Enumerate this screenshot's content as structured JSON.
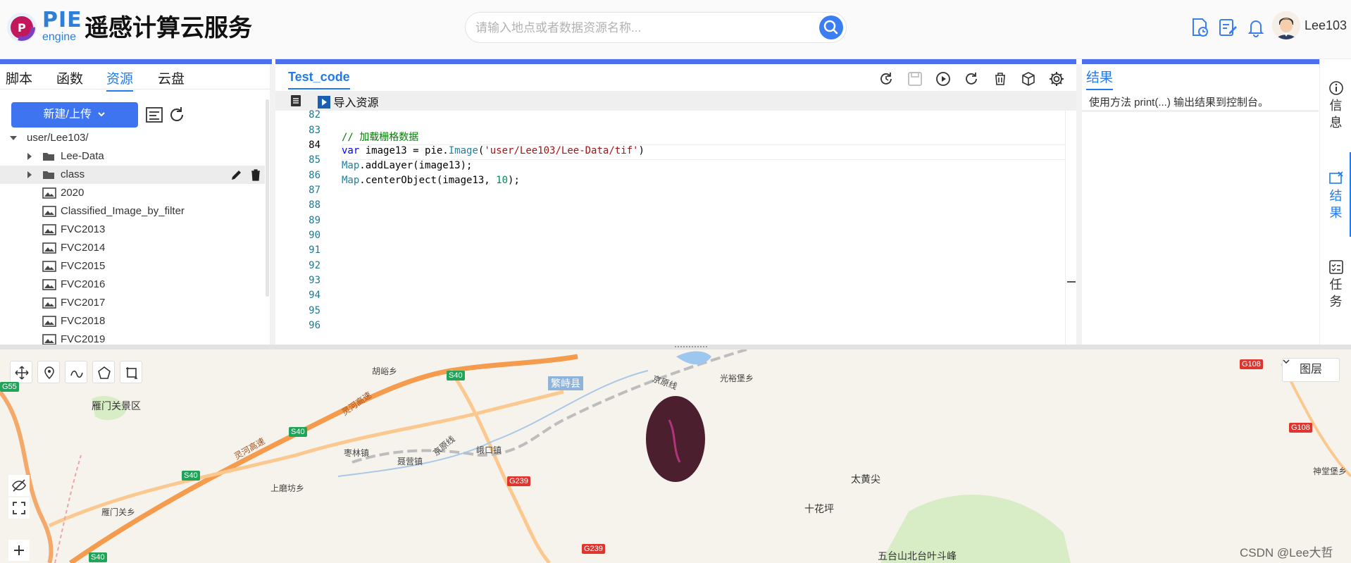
{
  "header": {
    "logo_pie": "PIE",
    "logo_engine": "engine",
    "title": "遥感计算云服务",
    "search_placeholder": "请输入地点或者数据资源名称...",
    "username": "Lee103"
  },
  "left_panel": {
    "tabs": [
      {
        "label": "脚本"
      },
      {
        "label": "函数"
      },
      {
        "label": "资源"
      },
      {
        "label": "云盘"
      }
    ],
    "new_button": "新建/上传",
    "tree": [
      {
        "label": "user/Lee103/"
      },
      {
        "label": "Lee-Data"
      },
      {
        "label": "class"
      },
      {
        "label": "2020"
      },
      {
        "label": "Classified_Image_by_filter"
      },
      {
        "label": "FVC2013"
      },
      {
        "label": "FVC2014"
      },
      {
        "label": "FVC2015"
      },
      {
        "label": "FVC2016"
      },
      {
        "label": "FVC2017"
      },
      {
        "label": "FVC2018"
      },
      {
        "label": "FVC2019"
      }
    ]
  },
  "editor": {
    "title": "Test_code",
    "import_label": "导入资源",
    "line_numbers": [
      "82",
      "83",
      "84",
      "85",
      "86",
      "87",
      "88",
      "89",
      "90",
      "91",
      "92",
      "93",
      "94",
      "95",
      "96"
    ],
    "code": {
      "comment": "// 加载栅格数据",
      "line84_kw": "var",
      "line84_a": " image13 = pie.",
      "line84_cls": "Image",
      "line84_b": "(",
      "line84_str": "'user/Lee103/Lee-Data/tif'",
      "line84_c": ")",
      "line85_obj": "Map",
      "line85_rest": ".addLayer(image13);",
      "line86_obj": "Map",
      "line86_a": ".centerObject(image13, ",
      "line86_num": "10",
      "line86_b": ");"
    }
  },
  "result": {
    "title": "结果",
    "hint": "使用方法 print(...) 输出结果到控制台。"
  },
  "rail": {
    "info": [
      "信",
      "息"
    ],
    "results": [
      "结",
      "果"
    ],
    "tasks": [
      "任",
      "务"
    ]
  },
  "map": {
    "layer_button": "图层",
    "places": {
      "p1": "胡峪乡",
      "p2": "雁门关景区",
      "p3": "繁峙县",
      "p4": "光裕堡乡",
      "p5": "枣林镇",
      "p6": "聂营镇",
      "p7": "峨口镇",
      "p8": "上磨坊乡",
      "p9": "雁门关乡",
      "p10": "太黄尖",
      "p11": "十花坪",
      "p12": "五台山北台叶斗峰",
      "p13": "神堂堡乡",
      "road1": "灵河高速",
      "road2": "灵河高速",
      "rail1": "京原线",
      "rail2": "京原线"
    },
    "shields": {
      "s40a": "S40",
      "s40b": "S40",
      "s40c": "S40",
      "s40d": "S40",
      "s40e": "S40",
      "g55": "G55",
      "g108a": "G108",
      "g108b": "G108",
      "g239a": "G239",
      "g239b": "G239"
    }
  },
  "watermark": "CSDN @Lee大哲",
  "colors": {
    "accent": "#1f7cf0",
    "brand_strip": "#4b6fef",
    "primary_button": "#3f74f0"
  }
}
